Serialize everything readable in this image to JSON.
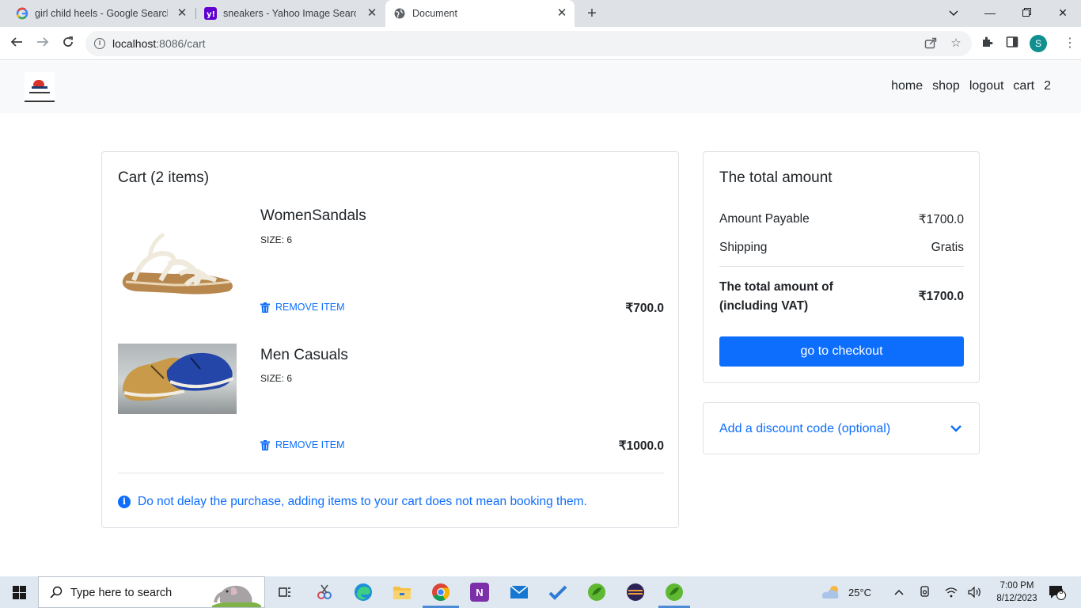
{
  "browser": {
    "tabs": [
      {
        "title": "girl child heels - Google Search",
        "icon": "google-icon"
      },
      {
        "title": "sneakers - Yahoo Image Search Results",
        "icon": "yahoo-icon"
      },
      {
        "title": "Document",
        "icon": "globe-icon"
      }
    ],
    "url_host": "localhost",
    "url_rest": ":8086/cart",
    "profile_initial": "S"
  },
  "nav": {
    "links": [
      "home",
      "shop",
      "logout",
      "cart",
      "2"
    ]
  },
  "cart": {
    "title": "Cart (2 items)",
    "items": [
      {
        "name": "WomenSandals",
        "size": "SIZE: 6",
        "remove_label": "REMOVE ITEM",
        "price": "₹700.0"
      },
      {
        "name": "Men Casuals",
        "size": "SIZE: 6",
        "remove_label": "REMOVE ITEM",
        "price": "₹1000.0"
      }
    ],
    "note": "Do not delay the purchase, adding items to your cart does not mean booking them."
  },
  "summary": {
    "title": "The total amount",
    "payable_label": "Amount Payable",
    "payable_value": "₹1700.0",
    "shipping_label": "Shipping",
    "shipping_value": "Gratis",
    "total_label_1": "The total amount of",
    "total_label_2": "(including VAT)",
    "total_value": "₹1700.0",
    "checkout_label": "go to checkout"
  },
  "discount": {
    "label": "Add a discount code (optional)"
  },
  "taskbar": {
    "search_placeholder": "Type here to search",
    "weather": "25°C",
    "time": "7:00 PM",
    "date": "8/12/2023",
    "notification_count": "3"
  },
  "colors": {
    "accent": "#0d6efd",
    "nav_bg": "#f8f9fa"
  }
}
